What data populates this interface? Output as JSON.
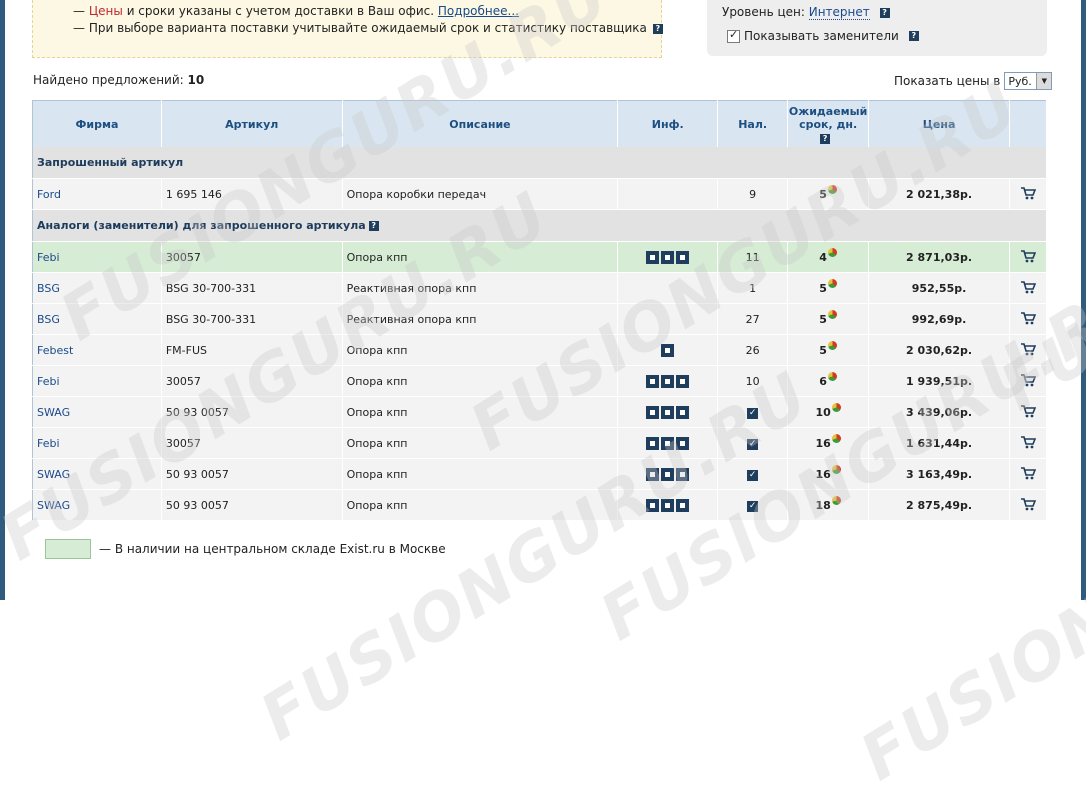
{
  "notice": {
    "line1_dash": "—",
    "line1_red": "Цены",
    "line1_rest": "и сроки указаны с учетом доставки в Ваш офис.",
    "line1_link": "Подробнее...",
    "line2": "— При выборе варианта поставки учитывайте ожидаемый срок и статистику поставщика"
  },
  "prefs": {
    "price_level_label": "Уровень цен:",
    "price_level_value": "Интернет",
    "show_substitutes_label": "Показывать заменители",
    "show_substitutes_checked": true
  },
  "found": {
    "label": "Найдено предложений:",
    "count": "10"
  },
  "currency": {
    "label": "Показать цены в",
    "selected": "Руб."
  },
  "table": {
    "headers": [
      "Фирма",
      "Артикул",
      "Описание",
      "Инф.",
      "Нал.",
      "Ожидаемый срок, дн.",
      "Цена"
    ],
    "section_requested": "Запрошенный артикул",
    "section_analogs": "Аналоги (заменители) для запрошенного артикула",
    "requested": {
      "brand": "Ford",
      "article": "1 695 146",
      "desc": "Опора коробки передач",
      "stock": "9",
      "days": "5",
      "price": "2 021,38р."
    },
    "analogs": [
      {
        "brand": "Febi",
        "article": "30057",
        "desc": "Опора кпп",
        "info": 3,
        "stock": "11",
        "days": "4",
        "price": "2 871,03р.",
        "highlight": true
      },
      {
        "brand": "BSG",
        "article": "BSG 30-700-331",
        "desc": "Реактивная опора кпп",
        "info": 0,
        "stock": "1",
        "days": "5",
        "price": "952,55р."
      },
      {
        "brand": "BSG",
        "article": "BSG 30-700-331",
        "desc": "Реактивная опора кпп",
        "info": 0,
        "stock": "27",
        "days": "5",
        "price": "992,69р."
      },
      {
        "brand": "Febest",
        "article": "FM-FUS",
        "desc": "Опора кпп",
        "info": 1,
        "stock": "26",
        "days": "5",
        "price": "2 030,62р."
      },
      {
        "brand": "Febi",
        "article": "30057",
        "desc": "Опора кпп",
        "info": 3,
        "stock": "10",
        "days": "6",
        "price": "1 939,51р."
      },
      {
        "brand": "SWAG",
        "article": "50 93 0057",
        "desc": "Опора кпп",
        "info": 3,
        "stock": "check",
        "days": "10",
        "price": "3 439,06р."
      },
      {
        "brand": "Febi",
        "article": "30057",
        "desc": "Опора кпп",
        "info": 3,
        "stock": "check",
        "days": "16",
        "price": "1 631,44р."
      },
      {
        "brand": "SWAG",
        "article": "50 93 0057",
        "desc": "Опора кпп",
        "info": 3,
        "stock": "check",
        "days": "16",
        "price": "3 163,49р."
      },
      {
        "brand": "SWAG",
        "article": "50 93 0057",
        "desc": "Опора кпп",
        "info": 3,
        "stock": "check",
        "days": "18",
        "price": "2 875,49р."
      }
    ]
  },
  "legend": {
    "text": "— В наличии на центральном складе Exist.ru в Москве"
  },
  "watermark": "FUSIONGURU.RU",
  "colors": {
    "highlight": "#d6ecd4",
    "header_bg": "#d9e6f2",
    "link": "#1a4a8a"
  }
}
